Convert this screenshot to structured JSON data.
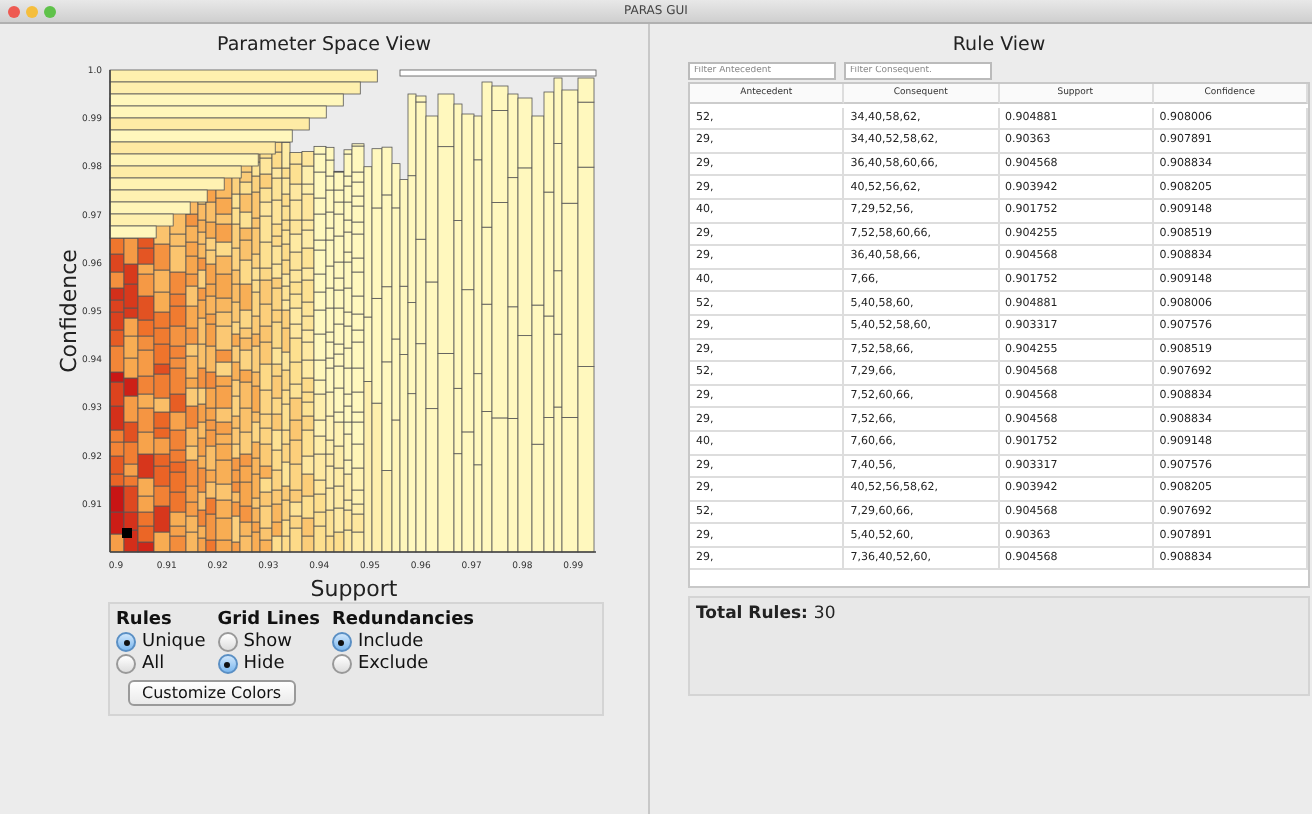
{
  "window": {
    "title": "PARAS GUI"
  },
  "parameter_space_view": {
    "title": "Parameter Space View",
    "ylabel": "Confidence",
    "xlabel": "Support",
    "yticks": [
      "1.0",
      "0.99",
      "0.98",
      "0.97",
      "0.96",
      "0.95",
      "0.94",
      "0.93",
      "0.92",
      "0.91"
    ],
    "xticks": [
      "0.9",
      "0.91",
      "0.92",
      "0.93",
      "0.94",
      "0.95",
      "0.96",
      "0.97",
      "0.98",
      "0.99"
    ]
  },
  "options": {
    "groups": [
      {
        "title": "Rules",
        "options": [
          {
            "label": "Unique",
            "selected": true
          },
          {
            "label": "All",
            "selected": false
          }
        ]
      },
      {
        "title": "Grid Lines",
        "options": [
          {
            "label": "Show",
            "selected": false
          },
          {
            "label": "Hide",
            "selected": true
          }
        ]
      },
      {
        "title": "Redundancies",
        "options": [
          {
            "label": "Include",
            "selected": true
          },
          {
            "label": "Exclude",
            "selected": false
          }
        ]
      }
    ],
    "button": "Customize Colors"
  },
  "rule_view": {
    "title": "Rule View",
    "filters": [
      {
        "placeholder": "Filter Antecedent"
      },
      {
        "placeholder": "Filter Consequent."
      }
    ],
    "columns": [
      "Antecedent",
      "Consequent",
      "Support",
      "Confidence"
    ],
    "rows": [
      [
        "52,",
        "34,40,58,62,",
        "0.904881",
        "0.908006"
      ],
      [
        "29,",
        "34,40,52,58,62,",
        "0.90363",
        "0.907891"
      ],
      [
        "29,",
        "36,40,58,60,66,",
        "0.904568",
        "0.908834"
      ],
      [
        "29,",
        "40,52,56,62,",
        "0.903942",
        "0.908205"
      ],
      [
        "40,",
        "7,29,52,56,",
        "0.901752",
        "0.909148"
      ],
      [
        "29,",
        "7,52,58,60,66,",
        "0.904255",
        "0.908519"
      ],
      [
        "29,",
        "36,40,58,66,",
        "0.904568",
        "0.908834"
      ],
      [
        "40,",
        "7,66,",
        "0.901752",
        "0.909148"
      ],
      [
        "52,",
        "5,40,58,60,",
        "0.904881",
        "0.908006"
      ],
      [
        "29,",
        "5,40,52,58,60,",
        "0.903317",
        "0.907576"
      ],
      [
        "29,",
        "7,52,58,66,",
        "0.904255",
        "0.908519"
      ],
      [
        "52,",
        "7,29,66,",
        "0.904568",
        "0.907692"
      ],
      [
        "29,",
        "7,52,60,66,",
        "0.904568",
        "0.908834"
      ],
      [
        "29,",
        "7,52,66,",
        "0.904568",
        "0.908834"
      ],
      [
        "40,",
        "7,60,66,",
        "0.901752",
        "0.909148"
      ],
      [
        "29,",
        "7,40,56,",
        "0.903317",
        "0.907576"
      ],
      [
        "29,",
        "40,52,56,58,62,",
        "0.903942",
        "0.908205"
      ],
      [
        "52,",
        "7,29,60,66,",
        "0.904568",
        "0.907692"
      ],
      [
        "29,",
        "5,40,52,60,",
        "0.90363",
        "0.907891"
      ],
      [
        "29,",
        "7,36,40,52,60,",
        "0.904568",
        "0.908834"
      ]
    ],
    "total_label": "Total Rules:",
    "total_value": "30"
  }
}
